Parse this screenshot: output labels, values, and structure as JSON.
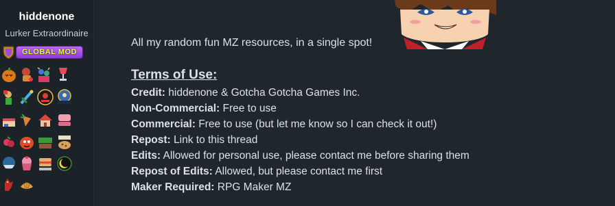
{
  "user": {
    "name": "hiddenone",
    "title": "Lurker Extraordinaire",
    "badge_label": "GLOBAL MOD",
    "colors": {
      "badge_bg": "#a855e6",
      "badge_text": "#d8ff3a"
    }
  },
  "trophies": [
    {
      "icon": "pumpkin-trophy-icon"
    },
    {
      "icon": "character-trophy-icon"
    },
    {
      "icon": "party-trophy-icon"
    },
    {
      "icon": "goblet-trophy-icon"
    },
    {
      "icon": "hero-trophy-icon"
    },
    {
      "icon": "sword-trophy-icon"
    },
    {
      "icon": "dark-orb-trophy-icon"
    },
    {
      "icon": "challenge-trophy-icon"
    },
    {
      "icon": "cake-trophy-icon"
    },
    {
      "icon": "carrot-trophy-icon"
    },
    {
      "icon": "house-trophy-icon"
    },
    {
      "icon": "candy-trophy-icon"
    },
    {
      "icon": "berry-trophy-icon"
    },
    {
      "icon": "creature-trophy-icon"
    },
    {
      "icon": "ticket-trophy-icon"
    },
    {
      "icon": "cookie-trophy-icon"
    },
    {
      "icon": "boat-trophy-icon"
    },
    {
      "icon": "cupcake-trophy-icon"
    },
    {
      "icon": "sandwich-trophy-icon"
    },
    {
      "icon": "moon-trophy-icon"
    },
    {
      "icon": "dragon-trophy-icon"
    },
    {
      "icon": "croissant-trophy-icon"
    }
  ],
  "post": {
    "intro": "All my random fun MZ resources, in a single spot!",
    "terms_title": "Terms of Use:",
    "terms": [
      {
        "label": "Credit:",
        "value": "hiddenone & Gotcha Gotcha Games Inc."
      },
      {
        "label": "Non-Commercial:",
        "value": "Free to use"
      },
      {
        "label": "Commercial:",
        "value": "Free to use (but let me know so I can check it out!)"
      },
      {
        "label": "Repost:",
        "value": "Link to this thread"
      },
      {
        "label": "Edits:",
        "value": "Allowed for personal use, please contact me before sharing them"
      },
      {
        "label": "Repost of Edits:",
        "value": "Allowed, but please contact me first"
      },
      {
        "label": "Maker Required:",
        "value": "RPG Maker MZ"
      }
    ]
  }
}
